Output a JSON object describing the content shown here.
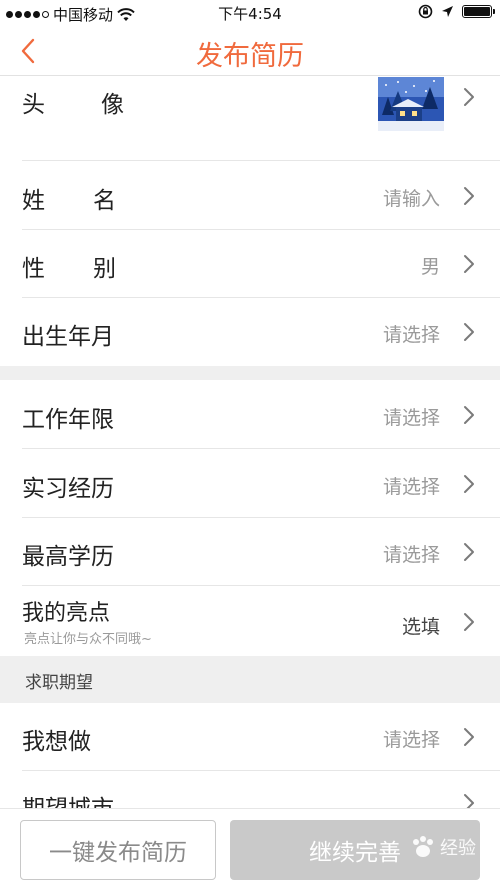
{
  "status_bar": {
    "carrier": "中国移动",
    "time": "下午4:54"
  },
  "nav": {
    "title": "发布简历"
  },
  "profile_rows": [
    {
      "label_chars": [
        "头",
        "像"
      ],
      "value": ""
    },
    {
      "label_chars": [
        "姓",
        "名"
      ],
      "value": "请输入"
    },
    {
      "label_chars": [
        "性",
        "别"
      ],
      "value": "男"
    },
    {
      "label": "出生年月",
      "value": "请选择"
    }
  ],
  "experience_rows": [
    {
      "label": "工作年限",
      "value": "请选择"
    },
    {
      "label": "实习经历",
      "value": "请选择"
    },
    {
      "label": "最高学历",
      "value": "请选择"
    },
    {
      "label": "我的亮点",
      "sublabel": "亮点让你与众不同哦~",
      "value": "选填"
    }
  ],
  "section_header": "求职期望",
  "expectation_rows": [
    {
      "label": "我想做",
      "value": "请选择"
    },
    {
      "label": "期望城市",
      "value": ""
    }
  ],
  "bottom": {
    "publish_button": "一键发布简历",
    "continue_button": "继续完善",
    "watermark_text": "经验"
  },
  "colors": {
    "accent": "#f06a3d",
    "muted_text": "#9a9a9a",
    "band": "#efefef",
    "disabled_button": "#c9c9c9"
  }
}
